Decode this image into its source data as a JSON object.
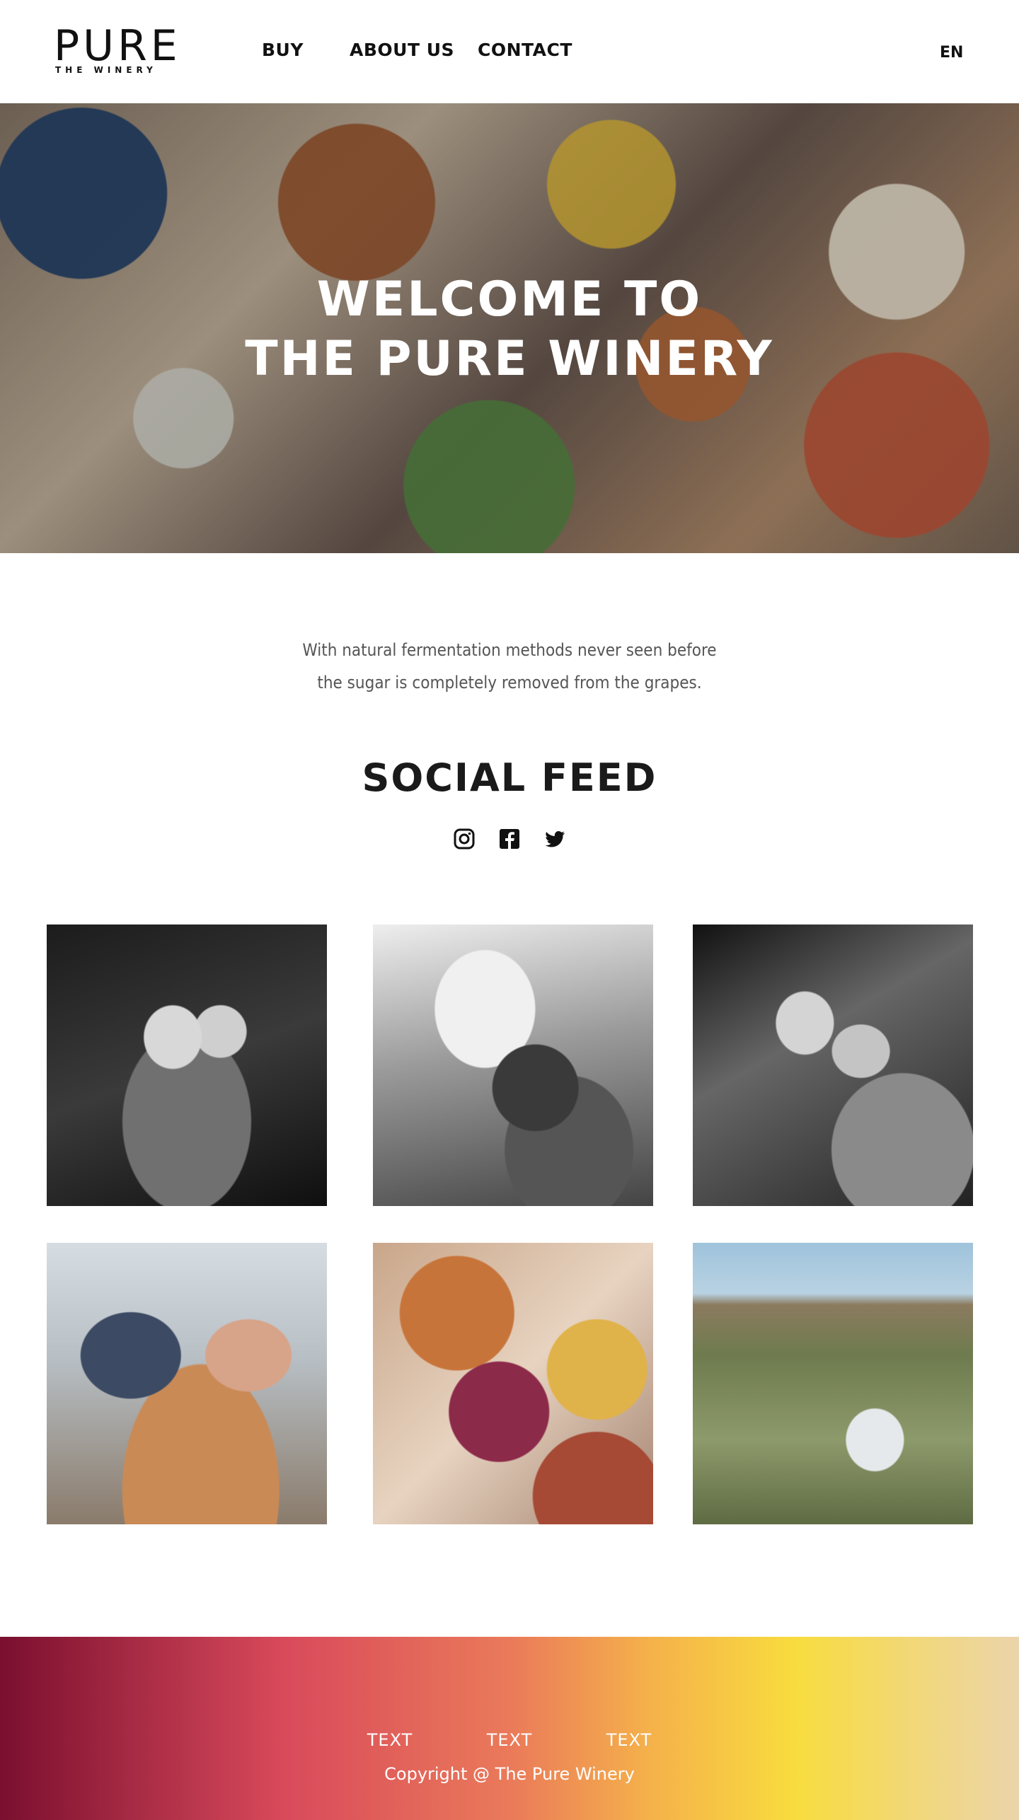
{
  "header": {
    "logo_text": "PURE",
    "logo_subtext": "THE WINERY",
    "nav": [
      {
        "label": "BUY"
      },
      {
        "label": "ABOUT US"
      },
      {
        "label": "CONTACT"
      }
    ],
    "language": "EN"
  },
  "hero": {
    "title_line1": "WELCOME TO",
    "title_line2": "THE PURE WINERY"
  },
  "intro": {
    "line1": "With natural fermentation methods never seen before",
    "line2": "the sugar is completely removed from the grapes."
  },
  "social": {
    "title": "SOCIAL FEED",
    "icons": [
      "instagram-icon",
      "facebook-icon",
      "twitter-icon"
    ]
  },
  "footer": {
    "links": [
      "TEXT",
      "TEXT",
      "TEXT"
    ],
    "copyright": "Copyright @ The Pure Winery"
  },
  "colors": {
    "footer_gradient": [
      "#7a0f2f",
      "#d94a5b",
      "#f8dc3e",
      "#ecd4ac"
    ]
  }
}
